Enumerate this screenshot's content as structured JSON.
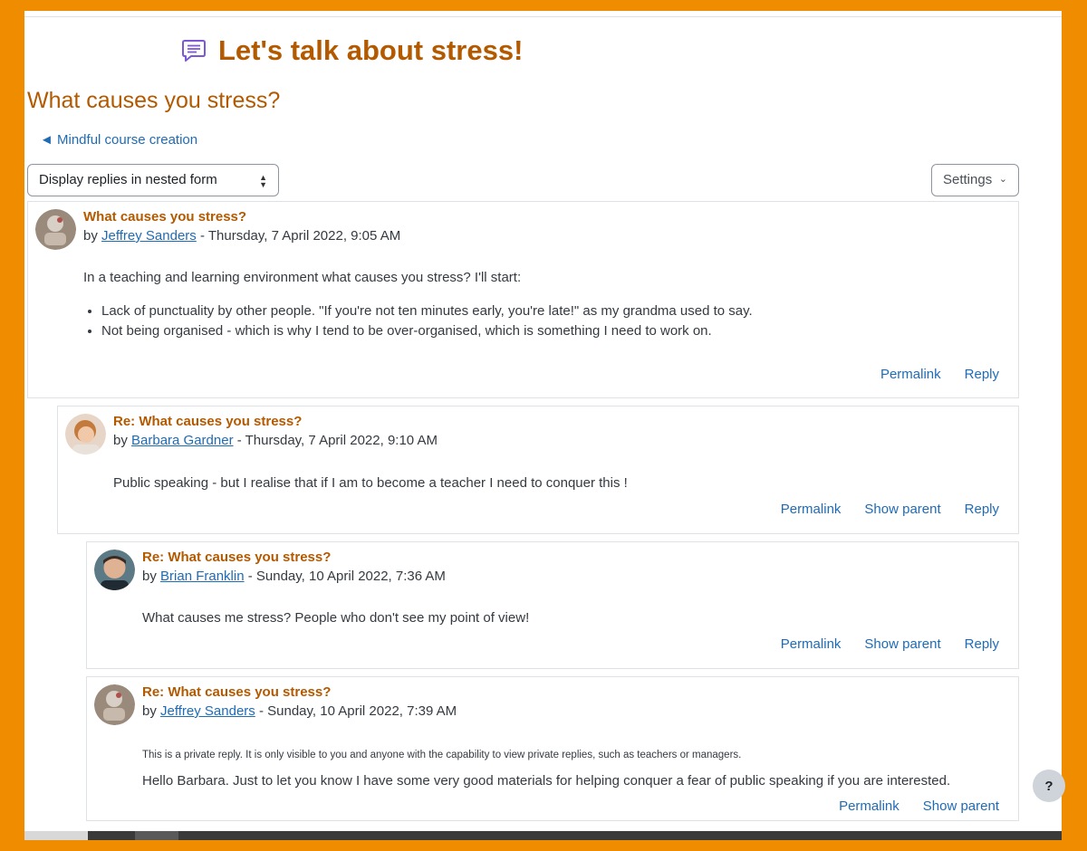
{
  "activity": {
    "title": "Let's talk about stress!",
    "icon": "forum-speech-bubble-icon"
  },
  "discussion": {
    "title": "What causes you stress?"
  },
  "nav": {
    "back_label": "◄ Mindful course creation"
  },
  "controls": {
    "display_mode": "Display replies in nested form",
    "settings_label": "Settings"
  },
  "colors": {
    "accent": "#b35900",
    "link": "#1f6bb6",
    "frame": "#f08c00"
  },
  "posts": [
    {
      "subject": "What causes you stress?",
      "by": "by",
      "author": "Jeffrey Sanders",
      "date": "- Thursday, 7 April 2022, 9:05 AM",
      "intro": "In a teaching and learning environment what causes you stress? I'll start:",
      "bullets": [
        "Lack of punctuality by other people. \"If you're not ten minutes early, you're late!\" as my grandma used to say.",
        "Not being organised - which is why I tend to be over-organised, which is something I need to work on."
      ],
      "actions": {
        "permalink": "Permalink",
        "reply": "Reply"
      }
    },
    {
      "subject": "Re: What causes you stress?",
      "by": "by",
      "author": "Barbara Gardner",
      "date": "- Thursday, 7 April 2022, 9:10 AM",
      "body": "Public speaking - but I realise that if I am to become a teacher I need to conquer this !",
      "actions": {
        "permalink": "Permalink",
        "show_parent": "Show parent",
        "reply": "Reply"
      }
    },
    {
      "subject": "Re: What causes you stress?",
      "by": "by",
      "author": "Brian Franklin",
      "date": "- Sunday, 10 April 2022, 7:36 AM",
      "body": "What causes me stress? People who don't see my point of view!",
      "actions": {
        "permalink": "Permalink",
        "show_parent": "Show parent",
        "reply": "Reply"
      }
    },
    {
      "subject": "Re: What causes you stress?",
      "by": "by",
      "author": "Jeffrey Sanders",
      "date": "- Sunday, 10 April 2022, 7:39 AM",
      "private_note": "This is a private reply. It is only visible to you and anyone with the capability to view private replies, such as teachers or managers.",
      "body": "Hello Barbara. Just to let you know I have some very good materials for helping conquer a fear of public speaking if you are interested.",
      "actions": {
        "permalink": "Permalink",
        "show_parent": "Show parent"
      }
    }
  ],
  "help": {
    "label": "?"
  }
}
